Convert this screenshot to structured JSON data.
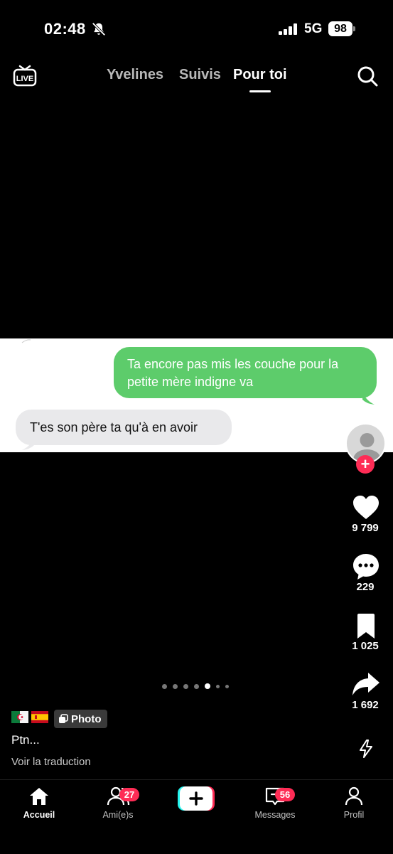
{
  "status_bar": {
    "time": "02:48",
    "network": "5G",
    "battery": "98"
  },
  "top_nav": {
    "tabs": [
      {
        "label": "Yvelines"
      },
      {
        "label": "Suivis"
      },
      {
        "label": "Pour toi"
      }
    ],
    "live_label": "LIVE"
  },
  "post": {
    "messages": {
      "sent": "Ta encore pas mis les couche pour la petite mère indigne va",
      "received": "T'es son père ta qu'à en avoir"
    },
    "flags": [
      "algeria-flag",
      "spain-flag"
    ],
    "photo_chip": "Photo",
    "caption": "Ptn...",
    "translate": "Voir la traduction",
    "carousel": {
      "total": 7,
      "active_index": 4
    }
  },
  "actions": {
    "likes": "9 799",
    "comments": "229",
    "saves": "1 025",
    "shares": "1 692"
  },
  "bottom_nav": {
    "home": "Accueil",
    "friends": "Ami(e)s",
    "friends_badge": "27",
    "messages": "Messages",
    "messages_badge": "56",
    "profile": "Profil"
  },
  "colors": {
    "accent": "#fe2c55",
    "sent_bubble": "#5dcc6b",
    "received_bubble": "#e9e9eb"
  }
}
